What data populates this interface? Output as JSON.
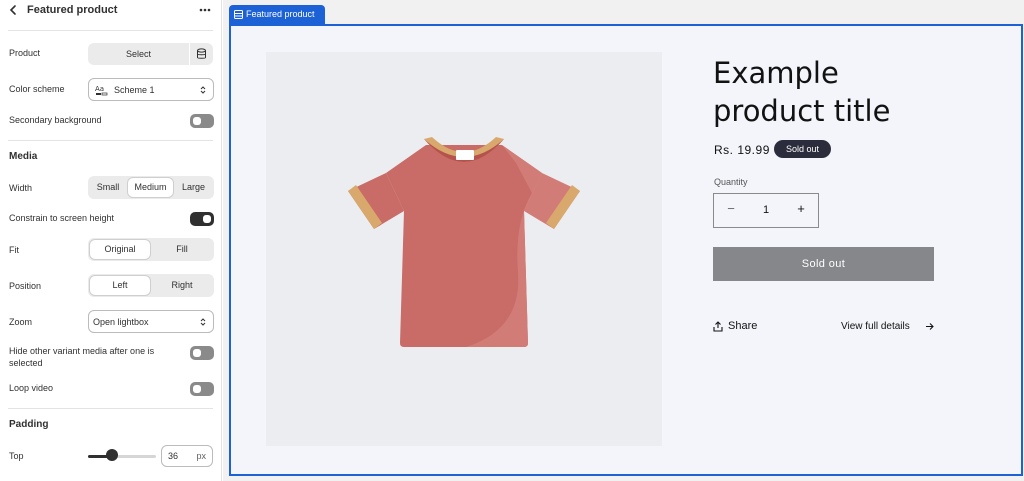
{
  "panel": {
    "title": "Featured product",
    "product": {
      "label": "Product",
      "button": "Select"
    },
    "color_scheme": {
      "label": "Color scheme",
      "value": "Scheme 1"
    },
    "secondary_background": {
      "label": "Secondary background",
      "on": false
    },
    "media": {
      "section": "Media",
      "width": {
        "label": "Width",
        "options": [
          "Small",
          "Medium",
          "Large"
        ],
        "selected": "Medium"
      },
      "constrain": {
        "label": "Constrain to screen height",
        "on": true
      },
      "fit": {
        "label": "Fit",
        "options": [
          "Original",
          "Fill"
        ],
        "selected": "Original"
      },
      "position": {
        "label": "Position",
        "options": [
          "Left",
          "Right"
        ],
        "selected": "Left"
      },
      "zoom": {
        "label": "Zoom",
        "value": "Open lightbox"
      },
      "hide_variant": {
        "label_line1": "Hide other variant media after one is",
        "label_line2": "selected",
        "on": false
      },
      "loop_video": {
        "label": "Loop video",
        "on": false
      }
    },
    "padding": {
      "section": "Padding",
      "top": {
        "label": "Top",
        "value": "36",
        "unit": "px",
        "fraction": 0.36
      }
    }
  },
  "preview": {
    "section_tag": "Featured product",
    "product_title": "Example product title",
    "price": "Rs. 19.99",
    "badge": "Sold out",
    "quantity_label": "Quantity",
    "quantity_value": "1",
    "quantity_minus": "−",
    "quantity_plus": "+",
    "sold_out_button": "Sold out",
    "share": "Share",
    "view_details": "View full details"
  },
  "colors": {
    "accent": "#1c61d6",
    "toggle_on": "#303030",
    "toggle_off": "#8a8a8a",
    "badge_bg": "#2b2d3c",
    "sold_out_bg": "#86878b",
    "shirt": "#c96b66",
    "shirt_trim": "#d9a86c"
  },
  "icons": [
    "chevron-left-icon",
    "more-horizontal-icon",
    "database-icon",
    "typography-icon",
    "select-chevron-icon",
    "section-icon",
    "share-icon",
    "arrow-right-icon"
  ]
}
